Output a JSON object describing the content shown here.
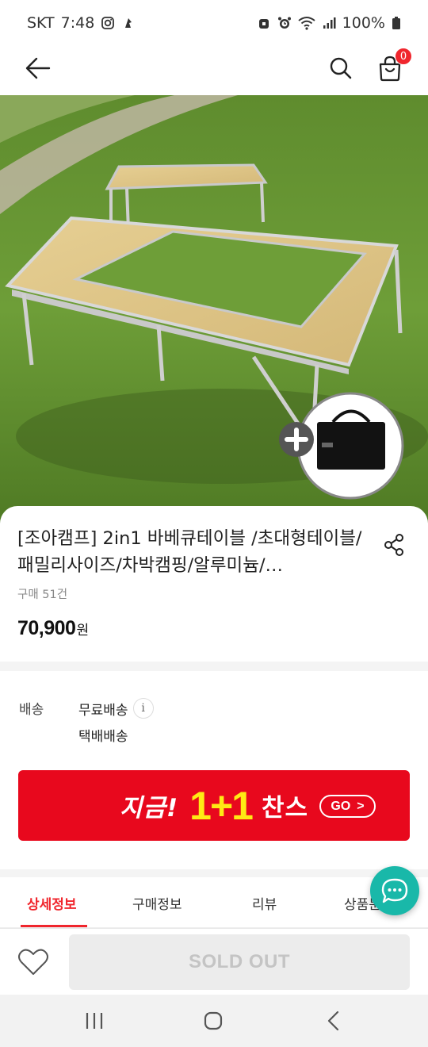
{
  "status_bar": {
    "carrier": "SKT",
    "time": "7:48",
    "battery": "100%",
    "icons": [
      "instagram-icon",
      "notification-icon",
      "alarm-lock-icon",
      "alarm-icon",
      "wifi-icon",
      "signal-icon",
      "battery-icon"
    ]
  },
  "header": {
    "cart_count": "0",
    "icons": [
      "back-arrow-icon",
      "search-icon",
      "shopping-bag-icon"
    ]
  },
  "product": {
    "title": "[조아캠프] 2in1 바베큐테이블 /초대형테이블/패밀리사이즈/차박캠핑/알루미늄/…",
    "purchase_count": "구매 51건",
    "price": "70,900",
    "price_unit": "원"
  },
  "delivery": {
    "label": "배송",
    "free_shipping": "무료배송",
    "info_icon": "i",
    "method": "택배배송"
  },
  "promo": {
    "text_now": "지금!",
    "text_offer": "1+1",
    "text_chance": "찬스",
    "button": "GO",
    "button_arrow": ">"
  },
  "tabs": [
    {
      "label": "상세정보",
      "active": true
    },
    {
      "label": "구매정보",
      "active": false
    },
    {
      "label": "리뷰",
      "active": false
    },
    {
      "label": "상품문의",
      "active": false
    }
  ],
  "bottom_bar": {
    "sold_out_label": "SOLD OUT"
  },
  "colors": {
    "accent_red": "#f0262d",
    "promo_red": "#e8081d",
    "promo_yellow": "#ffeb14",
    "chat_teal": "#19b8a9"
  }
}
